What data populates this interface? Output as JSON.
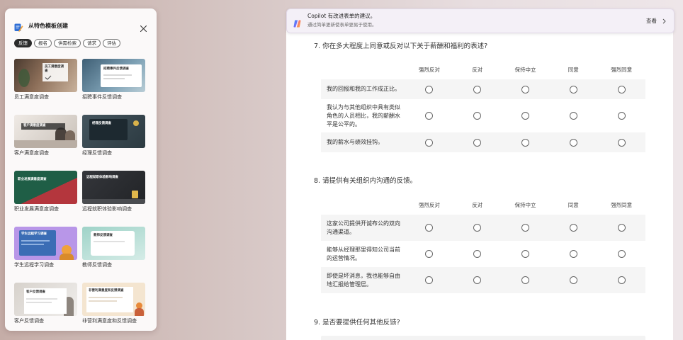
{
  "template_panel": {
    "title": "从特色模板创建",
    "icon": "form-template-icon",
    "close_icon": "close-icon",
    "tabs": [
      {
        "label": "反馈",
        "selected": true
      },
      {
        "label": "报名",
        "selected": false
      },
      {
        "label": "供需检索",
        "selected": false
      },
      {
        "label": "请求",
        "selected": false
      },
      {
        "label": "评估",
        "selected": false
      }
    ],
    "templates": [
      {
        "name": "员工满意度调查"
      },
      {
        "name": "招聘事件反馈调查"
      },
      {
        "name": "客户满意度调查"
      },
      {
        "name": "经理反馈调查"
      },
      {
        "name": "职业发展满意度调查"
      },
      {
        "name": "远程就职体验影响调查"
      },
      {
        "name": "学生远程学习调查"
      },
      {
        "name": "教师反馈调查"
      },
      {
        "name": "客户反馈调查"
      },
      {
        "name": "非营利满意度和反馈调查"
      }
    ]
  },
  "copilot_banner": {
    "icon": "copilot-icon",
    "title": "Copilot 有改进表单的建议。",
    "subtitle": "通过简单更新使表单更易于使用。",
    "action": "查看",
    "action_icon": "chevron-right-icon"
  },
  "form": {
    "questions": [
      {
        "title": "7. 你在多大程度上同意或反对以下关于薪酬和福利的表述?",
        "options": [
          "强烈反对",
          "反对",
          "保持中立",
          "同意",
          "强烈同意"
        ],
        "statements": [
          "我的回报和我的工作成正比。",
          "我认为与其他组织中具有类似角色的人员相比，我的薪酬水平是公平的。",
          "我的薪水与绩效挂钩。"
        ]
      },
      {
        "title": "8. 请提供有关组织内沟通的反馈。",
        "options": [
          "强烈反对",
          "反对",
          "保持中立",
          "同意",
          "强烈同意"
        ],
        "statements": [
          "这家公司提供开诚布公的双向沟通渠道。",
          "能够从经理那里得知公司当前的运营情况。",
          "即使是坏消息，我也能够自由地汇报给管理层。"
        ]
      },
      {
        "title": "9. 是否要提供任何其他反馈?"
      }
    ]
  },
  "colors": {
    "selected_tab_bg": "#2b2b2b",
    "row_shade": "#f5f5f5",
    "banner_bg": "#f4f0f7",
    "form_bg": "#ffffff"
  }
}
